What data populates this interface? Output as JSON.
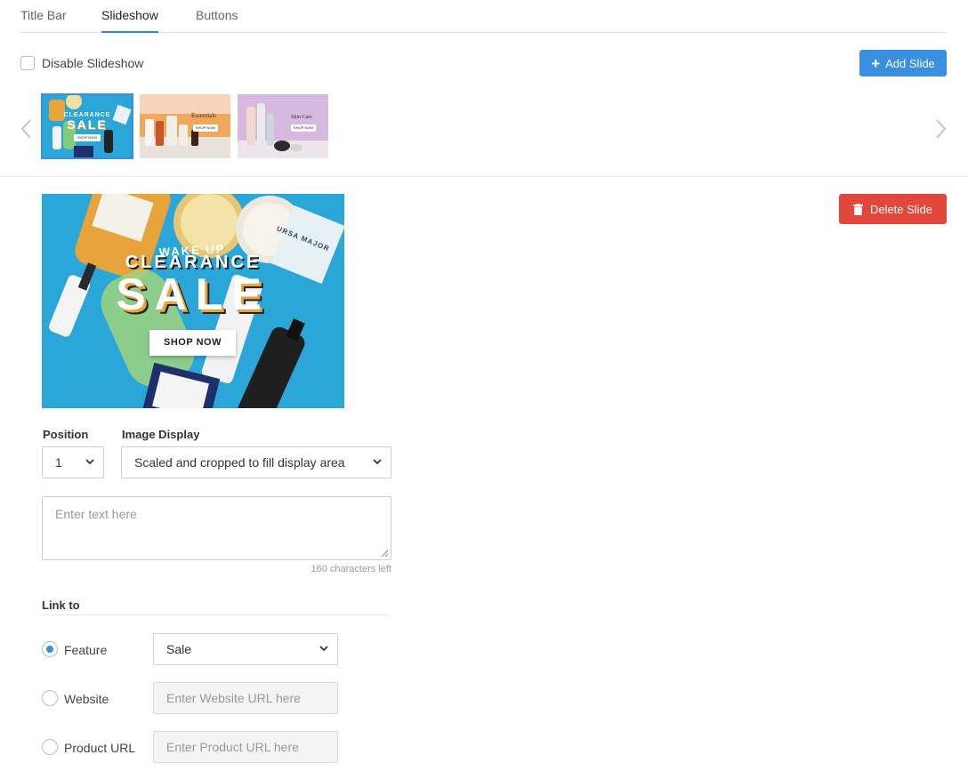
{
  "tabs": [
    {
      "label": "Title Bar"
    },
    {
      "label": "Slideshow"
    },
    {
      "label": "Buttons"
    }
  ],
  "slideshow": {
    "disable_label": "Disable Slideshow",
    "disable_checked": false,
    "add_slide_label": "Add Slide",
    "delete_slide_label": "Delete Slide"
  },
  "thumbnails": [
    {
      "title": "CLEARANCE",
      "subtitle": "SALE",
      "cta": "SHOP NOW",
      "selected": true
    },
    {
      "title": "Essentials",
      "cta": "SHOP NOW",
      "selected": false
    },
    {
      "title": "Skin Care",
      "cta": "SHOP NOW",
      "selected": false
    }
  ],
  "preview": {
    "headline": "CLEARANCE",
    "big": "SALE",
    "cta": "SHOP NOW",
    "product_a": "WAKE UP",
    "product_b": "URSA MAJOR"
  },
  "form": {
    "position_label": "Position",
    "position_value": "1",
    "image_display_label": "Image Display",
    "image_display_value": "Scaled and cropped to fill display area",
    "text_placeholder": "Enter text here",
    "chars_left": "160 characters left"
  },
  "link": {
    "title": "Link to",
    "options": [
      {
        "label": "Feature",
        "selected": true
      },
      {
        "label": "Website",
        "selected": false
      },
      {
        "label": "Product URL",
        "selected": false
      }
    ],
    "feature_value": "Sale",
    "website_placeholder": "Enter Website URL here",
    "product_placeholder": "Enter Product URL here"
  },
  "colors": {
    "accent": "#3a8fde",
    "danger": "#e3473b",
    "preview_bg": "#2aa6d8"
  }
}
